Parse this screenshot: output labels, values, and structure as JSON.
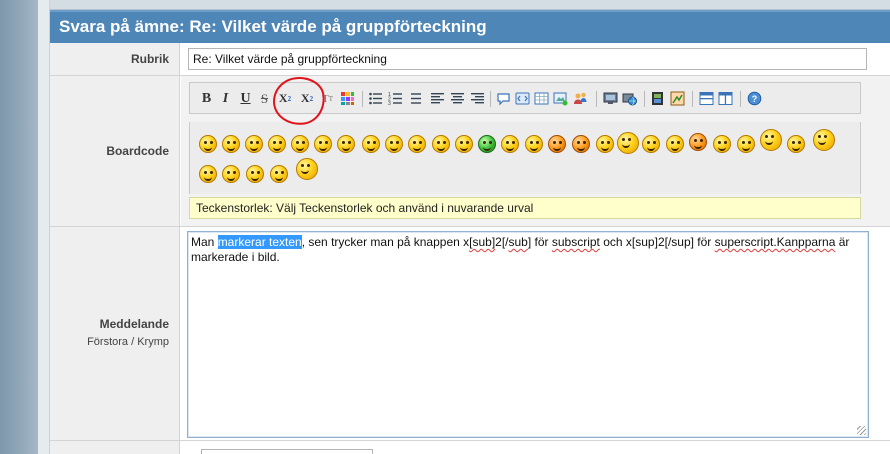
{
  "header": {
    "title": "Svara på ämne: Re: Vilket värde på gruppförteckning"
  },
  "form": {
    "subject": {
      "label": "Rubrik",
      "value": "Re: Vilket värde på gruppförteckning"
    },
    "boardcode": {
      "label": "Boardcode",
      "toolbar_text": {
        "bold": "B",
        "italic": "I",
        "underline": "U",
        "strike": "S",
        "subscript": "X",
        "subscript_mark": "2",
        "superscript": "X",
        "superscript_mark": "2",
        "font": "T",
        "font_small": "T"
      },
      "font_size_hint": "Teckenstorlek: Välj Teckenstorlek och använd i nuvarande urval"
    },
    "message": {
      "label": "Meddelande",
      "enlarge": "Förstora",
      "divider": "/",
      "shrink": "Krymp",
      "text": {
        "t1": "Man ",
        "t2": "markerar texten",
        "t3": ", sen trycker man på knappen x",
        "t4": "[sub]",
        "t5": "2[/",
        "t6": "sub",
        "t7": "] för ",
        "t8": "subscript",
        "t9": " och x[sup]2[/sup] för ",
        "t10": "superscript.Kanpparna",
        "t11": " är markerade i bild."
      }
    }
  },
  "colors": {
    "title_bar": "#4f86b8",
    "label_bg": "#efefef",
    "font_size_bar": "#ffffcc",
    "selection": "#3399ff",
    "annotation": "#e0141b"
  }
}
